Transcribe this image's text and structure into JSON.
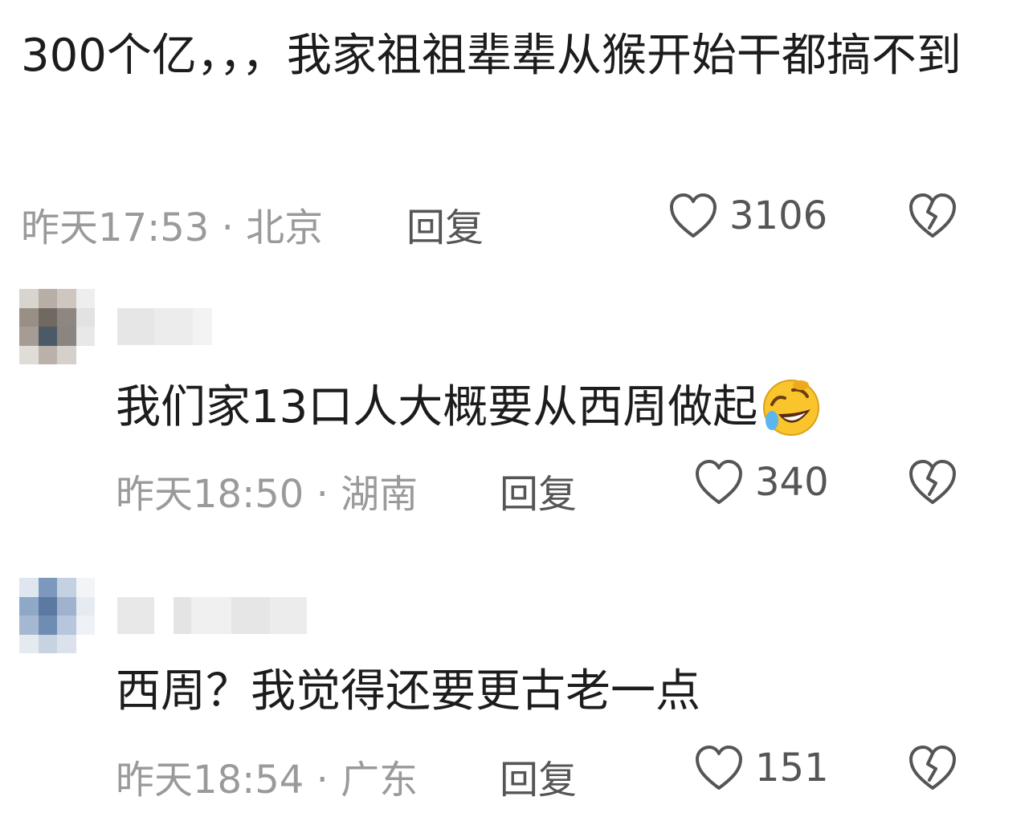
{
  "comments": [
    {
      "text": "300个亿，，，我家祖祖辈辈从猴开始干都搞不到",
      "time_location": "昨天17:53 · 北京",
      "reply_label": "回复",
      "likes": "3106"
    },
    {
      "text": "我们家13口人大概要从西周做起",
      "emoji": "rolling-on-floor-laughing-emoji",
      "time_location": "昨天18:50 · 湖南",
      "reply_label": "回复",
      "likes": "340"
    },
    {
      "text": "西周？我觉得还要更古老一点",
      "time_location": "昨天18:54 · 广东",
      "reply_label": "回复",
      "likes": "151"
    }
  ],
  "icons": {
    "like": "heart-outline-icon",
    "dislike": "broken-heart-icon"
  },
  "colors": {
    "text": "#1c1c1c",
    "meta": "#9a9a9a",
    "action": "#555555",
    "background": "#ffffff"
  }
}
